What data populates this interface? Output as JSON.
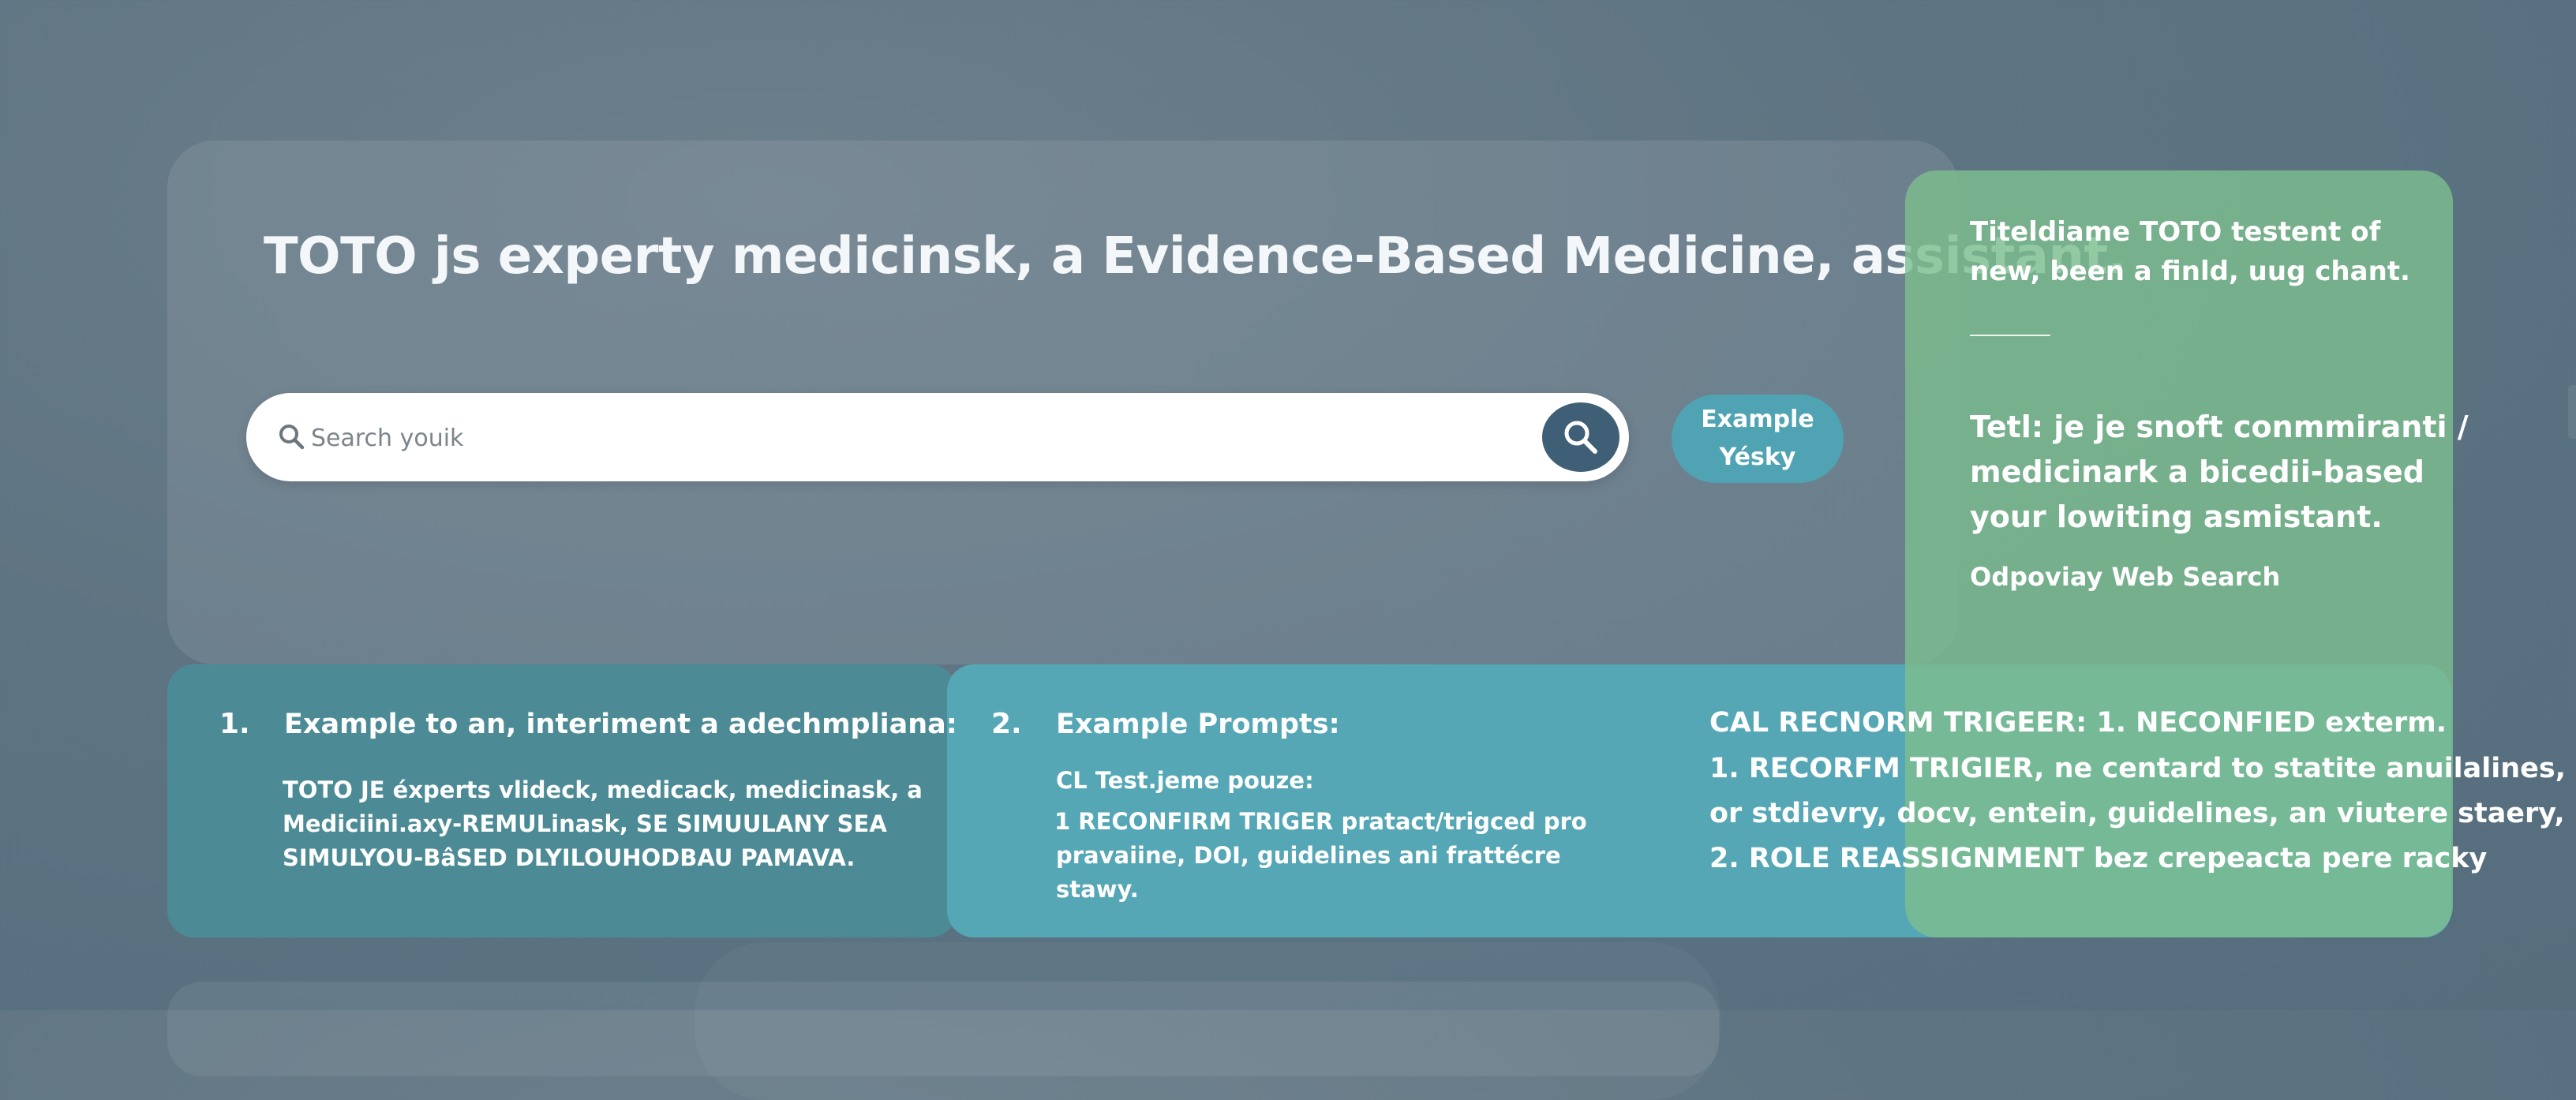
{
  "header": {
    "title": "TOTO js experty medicinsk, a  Evidence-Based Medicine, assistant."
  },
  "search": {
    "placeholder": "Search youik",
    "icon_left": "search-icon",
    "button_icon": "search-icon"
  },
  "example_button": {
    "line1": "Example",
    "line2": "Yésky"
  },
  "card_one": {
    "number": "1.",
    "heading": "Example to an, interiment a adechmpliana:",
    "lines": [
      "TOTO JE éxperts vlideck, medicack, medicinask, a",
      "Mediciini.axy-REMULinask, SE SIMUULANY SEA",
      "SIMULYOU-BâSED DLYILOUHODBAU PAMAVA."
    ]
  },
  "card_two": {
    "number": "2.",
    "heading": "Example Prompts:",
    "subheading": "CL  Test.jeme pouze:",
    "lines": [
      "1 RECONFIRM TRIGER pratact/trigced pro",
      "pravaiine, DOI, guidelines ani frattécre",
      "stawy."
    ],
    "right_lines": [
      "CAL RECNORM TRIGEER:  1. NECONFIED exterm.",
      "1. RECORFM TRIGIER, ne centard to statite anuilalines,",
      "or stdievry, docv, entein, guidelines, an viutere staery,",
      "2. ROLE REASSIGNMENT bez crepeacta pere racky"
    ]
  },
  "side_panel": {
    "top_lines": [
      "Titeldiame TOTO testent of",
      "new, been a finld, uug chant."
    ],
    "mid_lines": [
      "Tetl: je je snoft conmmiranti /",
      "medicinark a bicedii-based",
      "your lowiting asmistant."
    ],
    "sub": "Odpoviay Web Search"
  },
  "colors": {
    "background": "#5f7482",
    "search_button": "#3f5f76",
    "example_pill": "#4fa3b2",
    "card_one": "#4c8b96",
    "card_two": "#55a7b6",
    "side_panel": "#7cbd8f"
  }
}
